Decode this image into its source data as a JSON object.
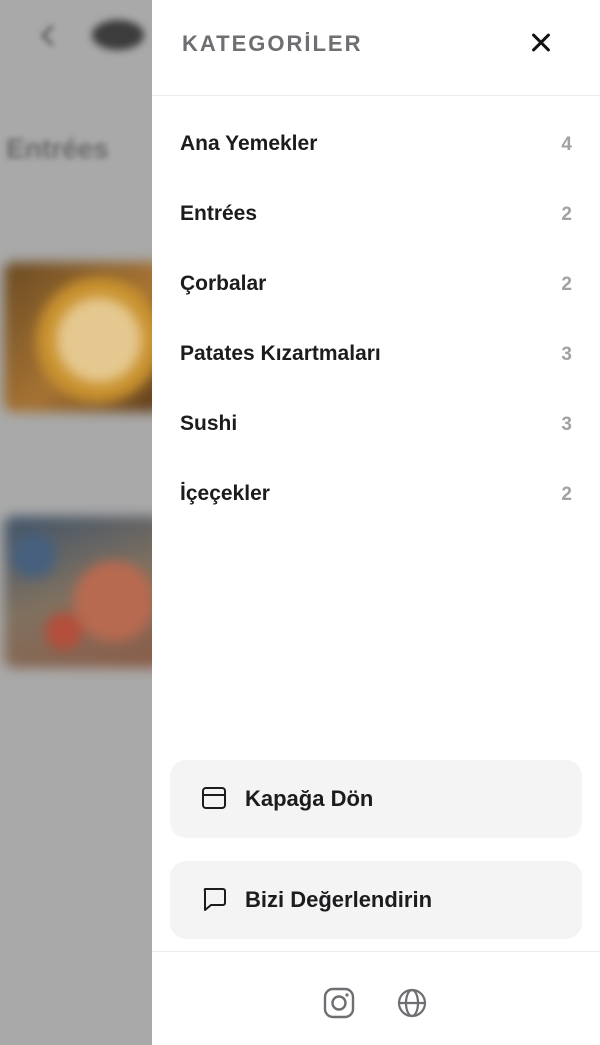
{
  "background": {
    "section_title": "Entrées"
  },
  "drawer": {
    "title": "KATEGORİLER",
    "categories": [
      {
        "name": "Ana Yemekler",
        "count": "4"
      },
      {
        "name": "Entrées",
        "count": "2"
      },
      {
        "name": "Çorbalar",
        "count": "2"
      },
      {
        "name": "Patates Kızartmaları",
        "count": "3"
      },
      {
        "name": "Sushi",
        "count": "3"
      },
      {
        "name": "İçeçekler",
        "count": "2"
      }
    ],
    "actions": {
      "cover_label": "Kapağa Dön",
      "rate_label": "Bizi Değerlendirin"
    },
    "icons": {
      "close": "close-icon",
      "cover": "card-icon",
      "rate": "chat-bubble-icon",
      "instagram": "instagram-icon",
      "web": "globe-icon"
    }
  }
}
